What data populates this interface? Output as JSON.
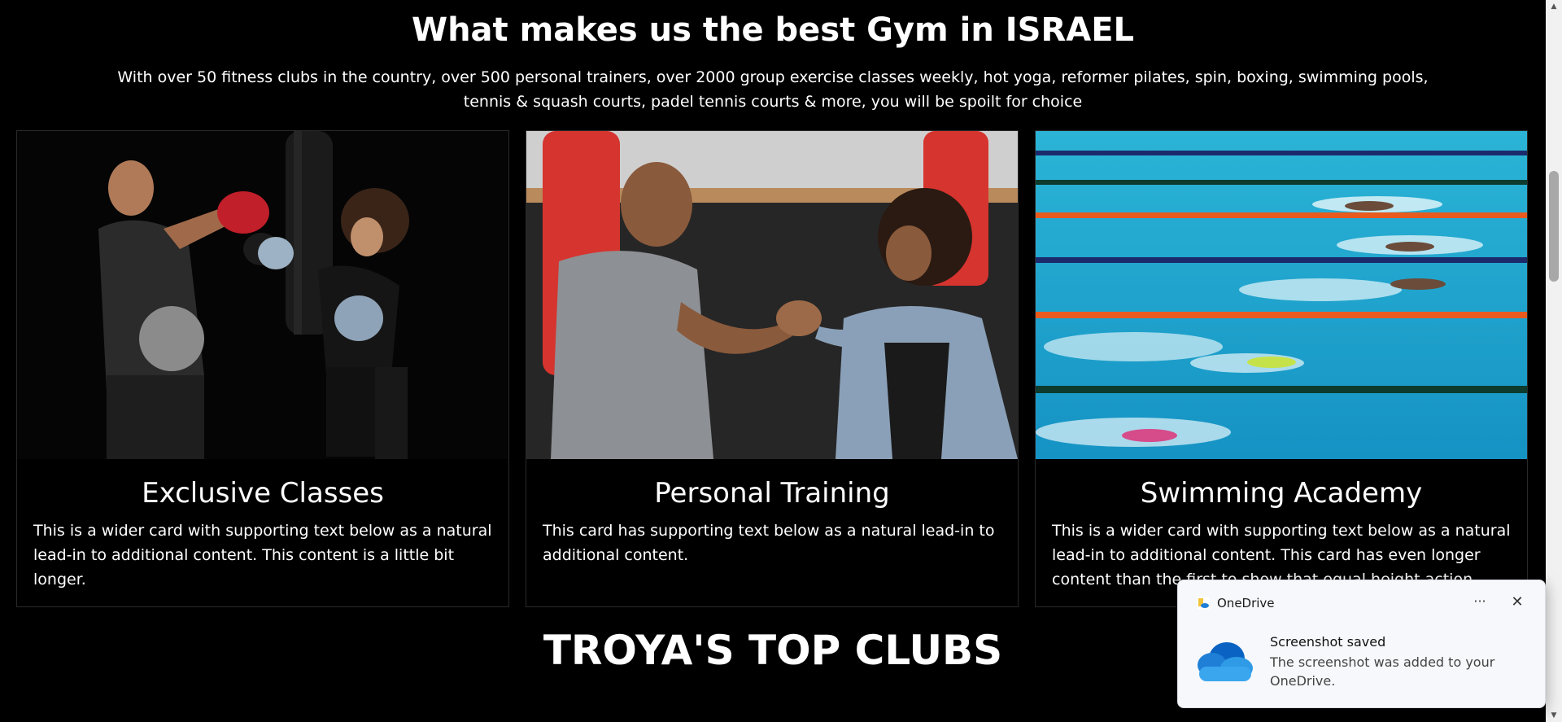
{
  "headline": "What makes us the best Gym in ISRAEL",
  "lead": "With over 50 fitness clubs in the country, over 500 personal trainers, over 2000 group exercise classes weekly, hot yoga, reformer pilates, spin, boxing, swimming pools, tennis & squash courts, padel tennis courts & more, you will be spoilt for choice",
  "cards": [
    {
      "image_icon": "boxing-photo",
      "title": "Exclusive Classes",
      "text": "This is a wider card with supporting text below as a natural lead-in to additional content. This content is a little bit longer."
    },
    {
      "image_icon": "handshake-photo",
      "title": "Personal Training",
      "text": "This card has supporting text below as a natural lead-in to additional content."
    },
    {
      "image_icon": "swimming-pool-photo",
      "title": "Swimming Academy",
      "text": "This is a wider card with supporting text below as a natural lead-in to additional content. This card has even longer content than the first to show that equal height action."
    }
  ],
  "section_title": "TROYA'S TOP CLUBS",
  "toast": {
    "app": "OneDrive",
    "more": "···",
    "close": "✕",
    "title": "Screenshot saved",
    "body": "The screenshot was added to your OneDrive."
  },
  "colors": {
    "background": "#000000",
    "text": "#ffffff",
    "toast_bg": "#f6f8fb",
    "onedrive_blue": "#1f7fd6"
  }
}
